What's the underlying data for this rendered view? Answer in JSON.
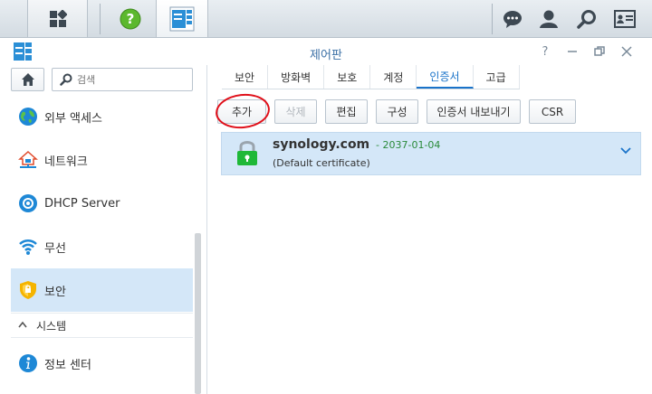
{
  "window": {
    "title": "제어판"
  },
  "sidebar": {
    "search_placeholder": "검색",
    "items": [
      {
        "label": "외부 액세스",
        "icon": "globe-icon"
      },
      {
        "label": "네트워크",
        "icon": "network-home-icon"
      },
      {
        "label": "DHCP Server",
        "icon": "dhcp-server-icon"
      },
      {
        "label": "무선",
        "icon": "wifi-icon"
      },
      {
        "label": "보안",
        "icon": "shield-icon",
        "active": true
      },
      {
        "label": "정보 센터",
        "icon": "info-icon"
      }
    ],
    "section_system": "시스템"
  },
  "tabs": [
    "보안",
    "방화벽",
    "보호",
    "계정",
    "인증서",
    "고급"
  ],
  "active_tab": "인증서",
  "toolbar": {
    "add": "추가",
    "delete": "삭제",
    "edit": "편집",
    "configure": "구성",
    "export": "인증서 내보내기",
    "csr": "CSR"
  },
  "certificate": {
    "name": "synology.com",
    "expiry": "- 2037-01-04",
    "description": "(Default certificate)"
  },
  "colors": {
    "accent": "#1a73c9",
    "selected_bg": "#d4e7f8",
    "lock_green": "#1fb838",
    "expiry_green": "#2a8a3a",
    "annotation_red": "#e0101a"
  }
}
